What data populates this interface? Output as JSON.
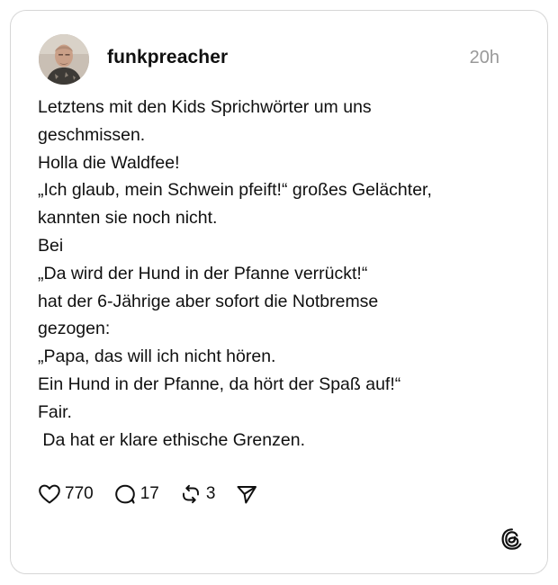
{
  "post": {
    "username": "funkpreacher",
    "timestamp": "20h",
    "lines": [
      "Letztens mit den Kids Sprichwörter um uns",
      "geschmissen.",
      "Holla die Waldfee!",
      "„Ich glaub, mein Schwein pfeift!“ großes Gelächter,",
      "kannten sie noch nicht.",
      "Bei",
      "„Da wird der Hund in der Pfanne verrückt!“",
      "hat der 6-Jährige aber sofort die Notbremse",
      "gezogen:",
      "„Papa, das will ich nicht hören.",
      "Ein Hund in der Pfanne, da hört der Spaß auf!“",
      "Fair.",
      " Da hat er klare ethische Grenzen."
    ]
  },
  "actions": {
    "likes": "770",
    "replies": "17",
    "reposts": "3"
  },
  "icons": {
    "like": "heart-icon",
    "reply": "speech-bubble-icon",
    "repost": "repost-icon",
    "share": "send-icon",
    "brand": "threads-logo-icon"
  },
  "colors": {
    "text": "#101010",
    "muted": "#999999",
    "border": "#d6d6d6"
  }
}
